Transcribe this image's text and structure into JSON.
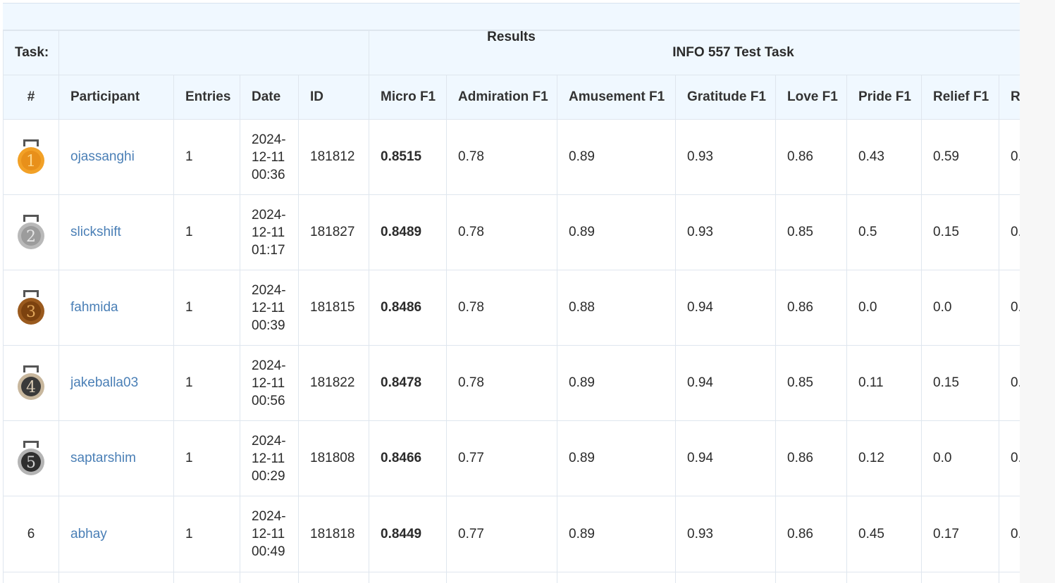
{
  "header": {
    "task_label": "Task:",
    "results_title": "Results",
    "task_name": "INFO 557 Test Task"
  },
  "columns": [
    "#",
    "Participant",
    "Entries",
    "Date",
    "ID",
    "Micro F1",
    "Admiration F1",
    "Amusement F1",
    "Gratitude F1",
    "Love F1",
    "Pride F1",
    "Relief F1",
    "R"
  ],
  "rows": [
    {
      "rank": "1",
      "medal": "gold",
      "participant": "ojassanghi",
      "entries": "1",
      "date_lines": [
        "2024-",
        "12-11",
        "00:36"
      ],
      "id": "181812",
      "micro": "0.8515",
      "admiration": "0.78",
      "amusement": "0.89",
      "gratitude": "0.93",
      "love": "0.86",
      "pride": "0.43",
      "relief": "0.59",
      "next": "0."
    },
    {
      "rank": "2",
      "medal": "silver",
      "participant": "slickshift",
      "entries": "1",
      "date_lines": [
        "2024-",
        "12-11",
        "01:17"
      ],
      "id": "181827",
      "micro": "0.8489",
      "admiration": "0.78",
      "amusement": "0.89",
      "gratitude": "0.93",
      "love": "0.85",
      "pride": "0.5",
      "relief": "0.15",
      "next": "0."
    },
    {
      "rank": "3",
      "medal": "bronze",
      "participant": "fahmida",
      "entries": "1",
      "date_lines": [
        "2024-",
        "12-11",
        "00:39"
      ],
      "id": "181815",
      "micro": "0.8486",
      "admiration": "0.78",
      "amusement": "0.88",
      "gratitude": "0.94",
      "love": "0.86",
      "pride": "0.0",
      "relief": "0.0",
      "next": "0."
    },
    {
      "rank": "4",
      "medal": "fourth",
      "participant": "jakeballa03",
      "entries": "1",
      "date_lines": [
        "2024-",
        "12-11",
        "00:56"
      ],
      "id": "181822",
      "micro": "0.8478",
      "admiration": "0.78",
      "amusement": "0.89",
      "gratitude": "0.94",
      "love": "0.85",
      "pride": "0.11",
      "relief": "0.15",
      "next": "0."
    },
    {
      "rank": "5",
      "medal": "fifth",
      "participant": "saptarshim",
      "entries": "1",
      "date_lines": [
        "2024-",
        "12-11",
        "00:29"
      ],
      "id": "181808",
      "micro": "0.8466",
      "admiration": "0.77",
      "amusement": "0.89",
      "gratitude": "0.94",
      "love": "0.86",
      "pride": "0.12",
      "relief": "0.0",
      "next": "0."
    },
    {
      "rank": "6",
      "medal": "",
      "participant": "abhay",
      "entries": "1",
      "date_lines": [
        "2024-",
        "12-11",
        "00:49"
      ],
      "id": "181818",
      "micro": "0.8449",
      "admiration": "0.77",
      "amusement": "0.89",
      "gratitude": "0.93",
      "love": "0.86",
      "pride": "0.45",
      "relief": "0.17",
      "next": "0."
    }
  ],
  "medal_colors": {
    "gold": {
      "outer": "#f2a127",
      "inner": "#e8901a",
      "text": "#ffd88a",
      "ribbon": "#555555"
    },
    "silver": {
      "outer": "#b9b9b9",
      "inner": "#9c9c9c",
      "text": "#e6e6e6",
      "ribbon": "#555555"
    },
    "bronze": {
      "outer": "#9a5a1e",
      "inner": "#7c420f",
      "text": "#e0a65a",
      "ribbon": "#555555"
    },
    "fourth": {
      "outer": "#c8b79d",
      "inner": "#3a3a3a",
      "text": "#d9cbb5",
      "ribbon": "#555555"
    },
    "fifth": {
      "outer": "#b4b4b4",
      "inner": "#2f2f2f",
      "text": "#cfcfcf",
      "ribbon": "#555555"
    }
  }
}
